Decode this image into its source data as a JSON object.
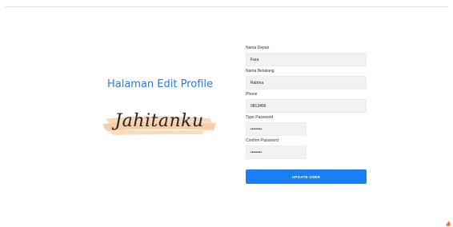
{
  "page": {
    "title": "Halaman Edit Profile",
    "logo_text": "Jahitanku"
  },
  "form": {
    "fields": [
      {
        "label": "Nama Depan",
        "value": "Fara"
      },
      {
        "label": "Nama Belakang",
        "value": "Rahma"
      },
      {
        "label": "Phone",
        "value": "0813456"
      },
      {
        "label": "Type Password",
        "value": "••••••••"
      },
      {
        "label": "Confirm Password",
        "value": "••••••••"
      }
    ],
    "submit_label": "UPDATE USER"
  },
  "colors": {
    "accent": "#1a7ef7",
    "title": "#2b7bd4",
    "logo_brush": "#f7d3b0",
    "badge": "#f26a21"
  },
  "icons": {
    "corner_badge": "flame-icon"
  }
}
